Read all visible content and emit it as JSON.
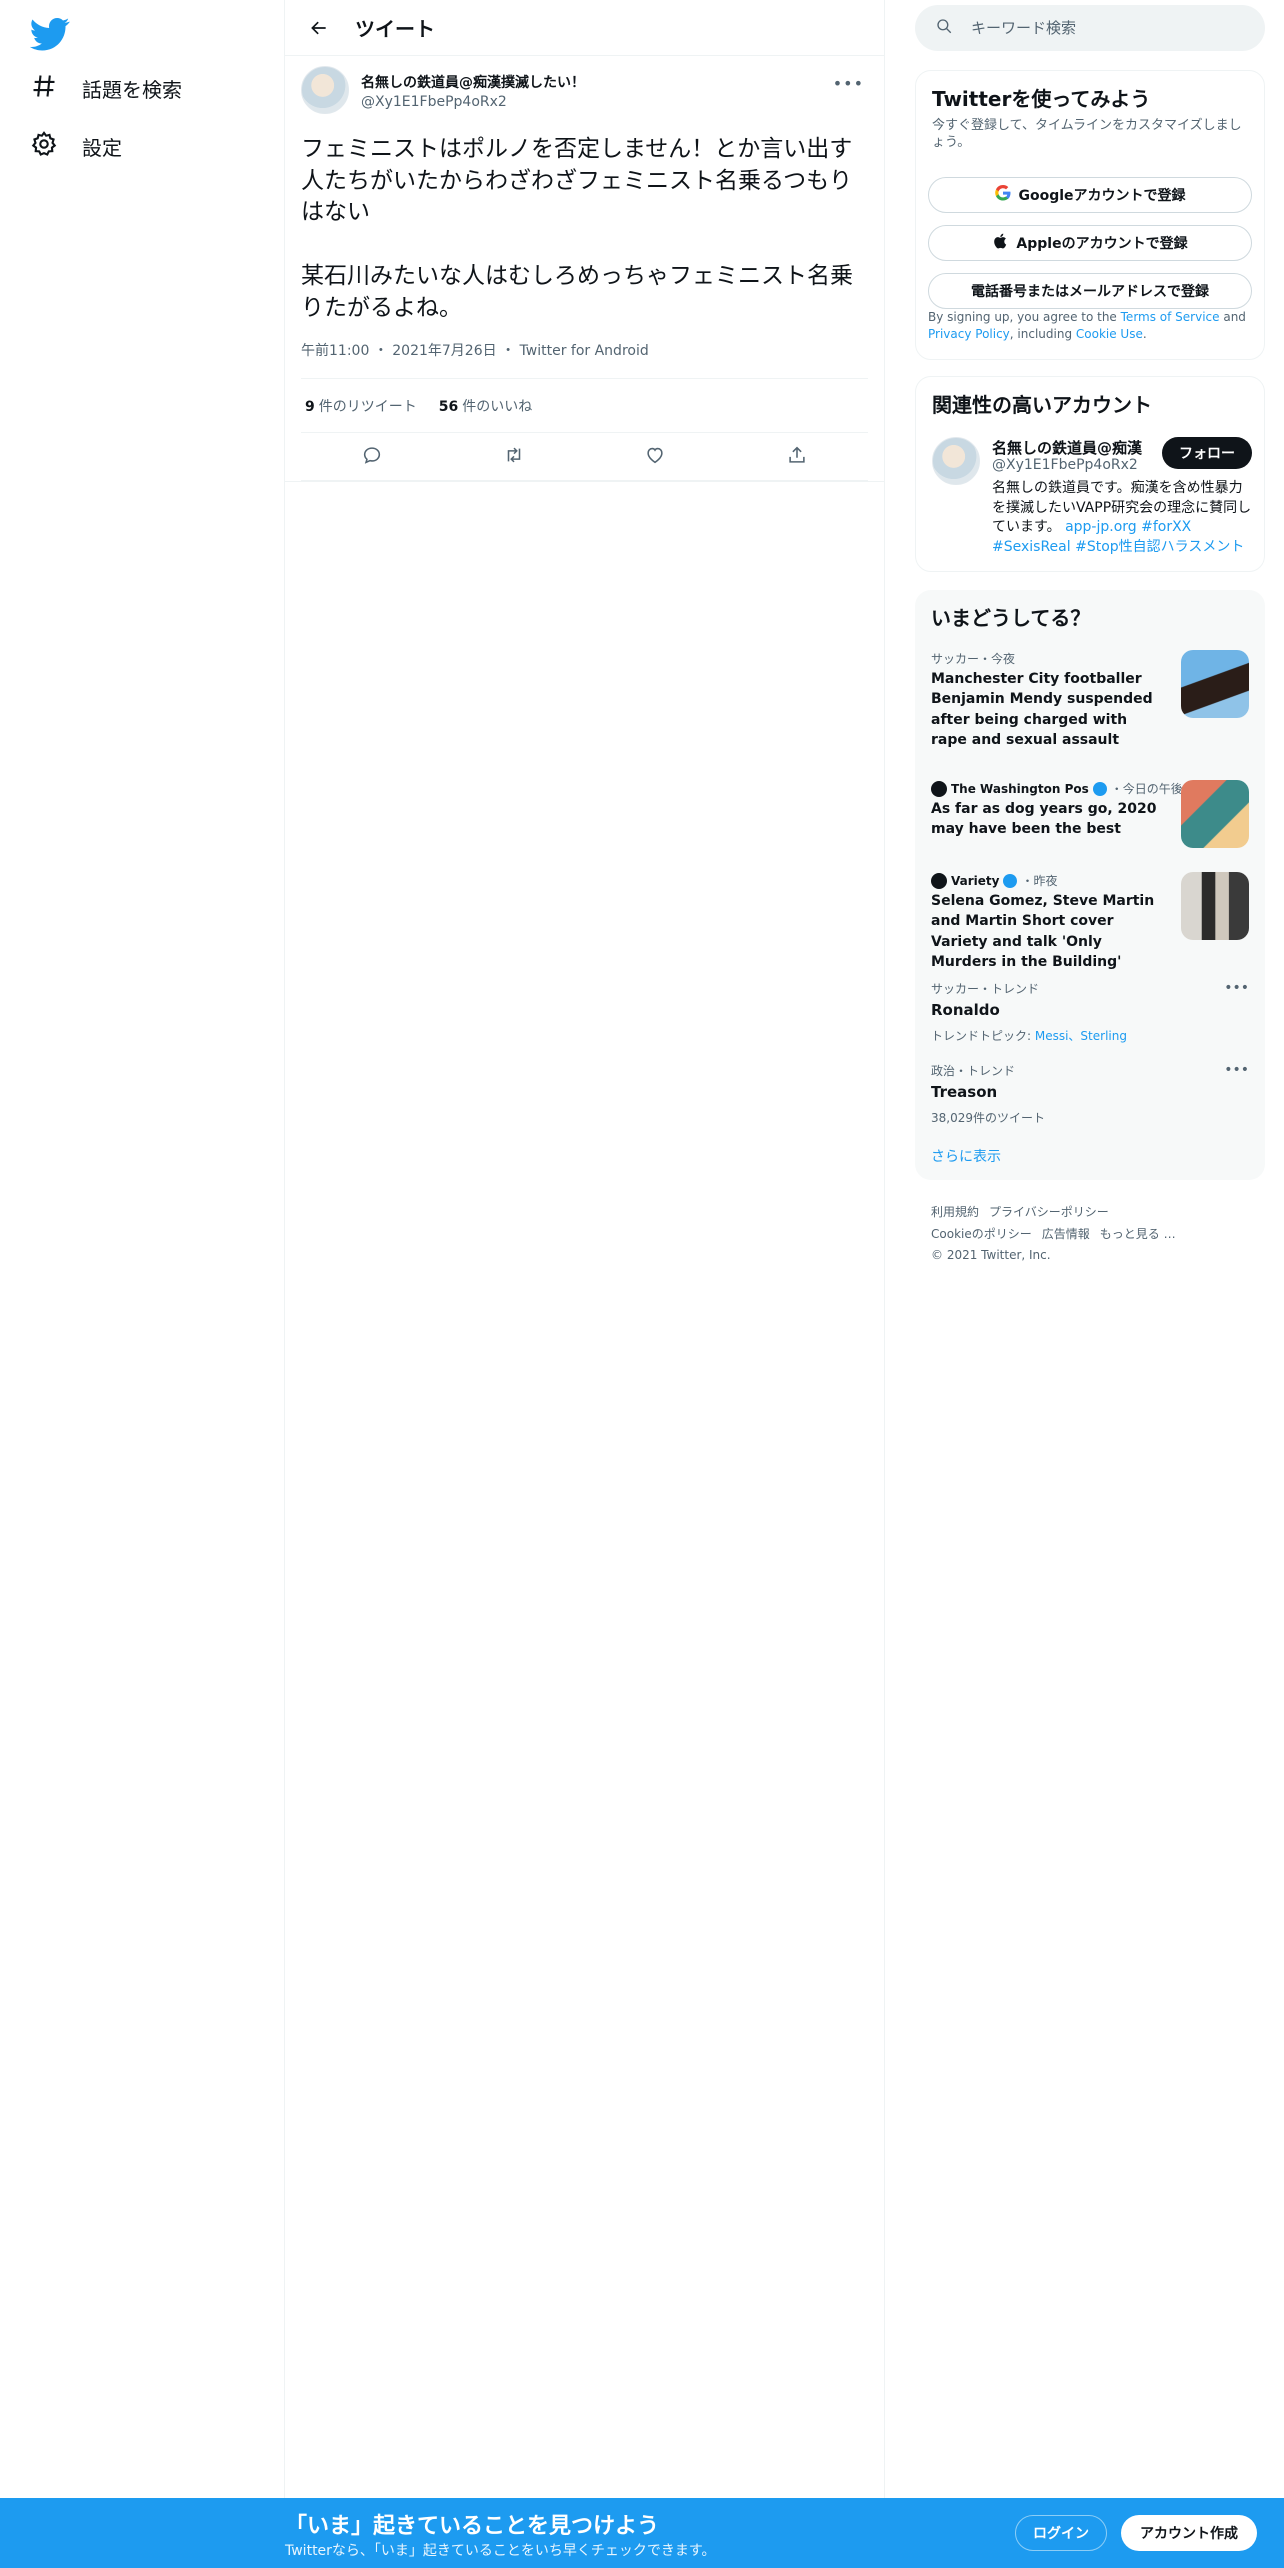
{
  "nav": {
    "items": [
      {
        "label": "話題を検索",
        "icon": "hashtag-icon"
      },
      {
        "label": "設定",
        "icon": "gear-icon"
      }
    ]
  },
  "header": {
    "title": "ツイート"
  },
  "tweet": {
    "display_name": "名無しの鉄道員@痴漢撲滅したい！",
    "handle": "@Xy1E1FbePp4oRx2",
    "text": "フェミニストはポルノを否定しません！とか言い出す人たちがいたからわざわざフェミニスト名乗るつもりはない\n\n某石川みたいな人はむしろめっちゃフェミニスト名乗りたがるよね。",
    "time": "午前11:00",
    "date": "2021年7月26日",
    "client": "Twitter for Android",
    "retweets": "9",
    "retweets_label": "件のリツイート",
    "likes": "56",
    "likes_label": "件のいいね"
  },
  "search": {
    "placeholder": "キーワード検索"
  },
  "signup_card": {
    "title": "Twitterを使ってみよう",
    "subtitle": "今すぐ登録して、タイムラインをカスタマイズしましょう。",
    "google": "Googleアカウントで登録",
    "apple": "Appleのアカウントで登録",
    "phone": "電話番号またはメールアドレスで登録",
    "legal_pre": "By signing up, you agree to the ",
    "legal_tos": "Terms of Service",
    "legal_and": " and ",
    "legal_privacy": "Privacy Policy",
    "legal_mid": ", including ",
    "legal_cookie": "Cookie Use",
    "legal_end": "."
  },
  "related": {
    "title": "関連性の高いアカウント",
    "name": "名無しの鉄道員@痴漢撲滅したい！",
    "handle": "@Xy1E1FbePp4oRx2",
    "follow": "フォロー",
    "bio": "名無しの鉄道員です。痴漢を含め性暴力を撲滅したいVAPP研究会の理念に賛同しています。",
    "bio_link": "app-jp.org",
    "bio_tags": "#forXX #SexisReal #Stop性自認ハラスメント"
  },
  "trends": {
    "title": "いまどうしてる？",
    "items": [
      {
        "category": "サッカー・今夜",
        "headline": "Manchester City footballer Benjamin Mendy suspended after being charged with rape and sexual assault"
      },
      {
        "source": "The Washington Pos",
        "meta": "・今日の午後",
        "headline": "As far as dog years go, 2020 may have been the best"
      },
      {
        "source": "Variety",
        "meta": "・昨夜",
        "headline": "Selena Gomez, Steve Martin and Martin Short cover Variety and talk 'Only Murders in the Building'"
      },
      {
        "category": "サッカー・トレンド",
        "name": "Ronaldo",
        "sub_label": "トレンドトピック: ",
        "sub_links": "Messi、Sterling"
      },
      {
        "category": "政治・トレンド",
        "name": "Treason",
        "sub": "38,029件のツイート"
      }
    ],
    "show_more": "さらに表示"
  },
  "footer": {
    "links": [
      "利用規約",
      "プライバシーポリシー",
      "Cookieのポリシー",
      "広告情報",
      "もっと見る …"
    ],
    "copyright": "© 2021 Twitter, Inc."
  },
  "bottom_bar": {
    "headline": "「いま」起きていることを見つけよう",
    "sub": "Twitterなら、「いま」起きていることをいち早くチェックできます。",
    "login": "ログイン",
    "signup": "アカウント作成"
  },
  "colors": {
    "accent": "#1d9bf0",
    "text": "#0f1419",
    "muted": "#536471"
  }
}
